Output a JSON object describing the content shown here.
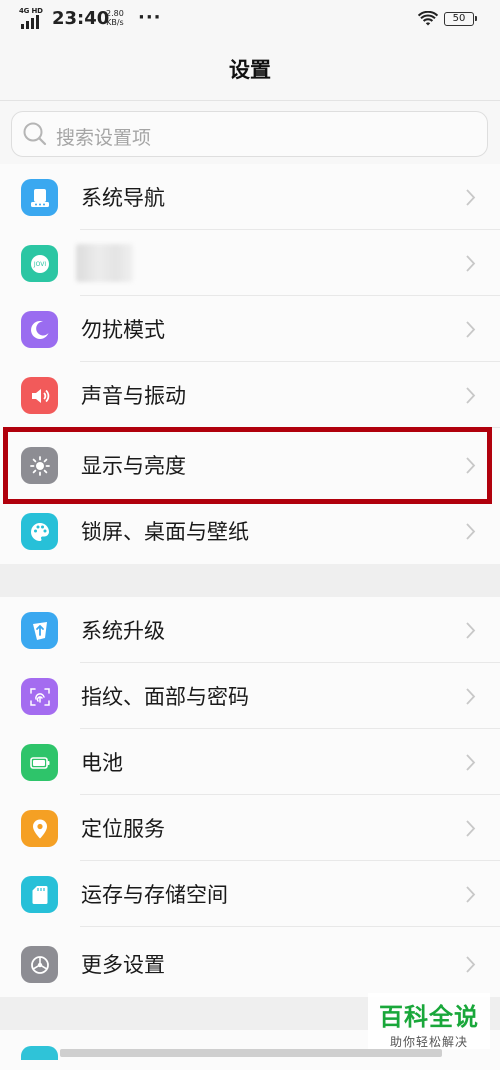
{
  "status_bar": {
    "network": "4G HD",
    "time": "23:40",
    "speed_value": "2.80",
    "speed_unit": "KB/s",
    "more": "···",
    "battery": "50"
  },
  "header": {
    "title": "设置"
  },
  "search": {
    "placeholder": "搜索设置项"
  },
  "groups": [
    {
      "items": [
        {
          "label": "系统导航",
          "icon": "navigation-icon",
          "color": "#3aa8f0"
        },
        {
          "label": "",
          "icon": "jovi-icon",
          "color": "#2bc6a3"
        },
        {
          "label": "勿扰模式",
          "icon": "moon-icon",
          "color": "#9a6cf0"
        },
        {
          "label": "声音与振动",
          "icon": "speaker-icon",
          "color": "#f25a5a"
        },
        {
          "label": "显示与亮度",
          "icon": "sun-icon",
          "color": "#8d8d93"
        },
        {
          "label": "锁屏、桌面与壁纸",
          "icon": "palette-icon",
          "color": "#27c0d8"
        }
      ]
    },
    {
      "items": [
        {
          "label": "系统升级",
          "icon": "upgrade-icon",
          "color": "#3aa8f0"
        },
        {
          "label": "指纹、面部与密码",
          "icon": "fingerprint-icon",
          "color": "#a46cf0"
        },
        {
          "label": "电池",
          "icon": "battery-icon",
          "color": "#2ec46a"
        },
        {
          "label": "定位服务",
          "icon": "location-icon",
          "color": "#f5a024"
        },
        {
          "label": "运存与存储空间",
          "icon": "sd-card-icon",
          "color": "#27c0d8"
        },
        {
          "label": "更多设置",
          "icon": "gear-icon",
          "color": "#8d8d93"
        }
      ]
    }
  ],
  "highlight_color": "#b0000c",
  "watermark": {
    "brand": "百科全说",
    "slogan": "助你轻松解决"
  }
}
